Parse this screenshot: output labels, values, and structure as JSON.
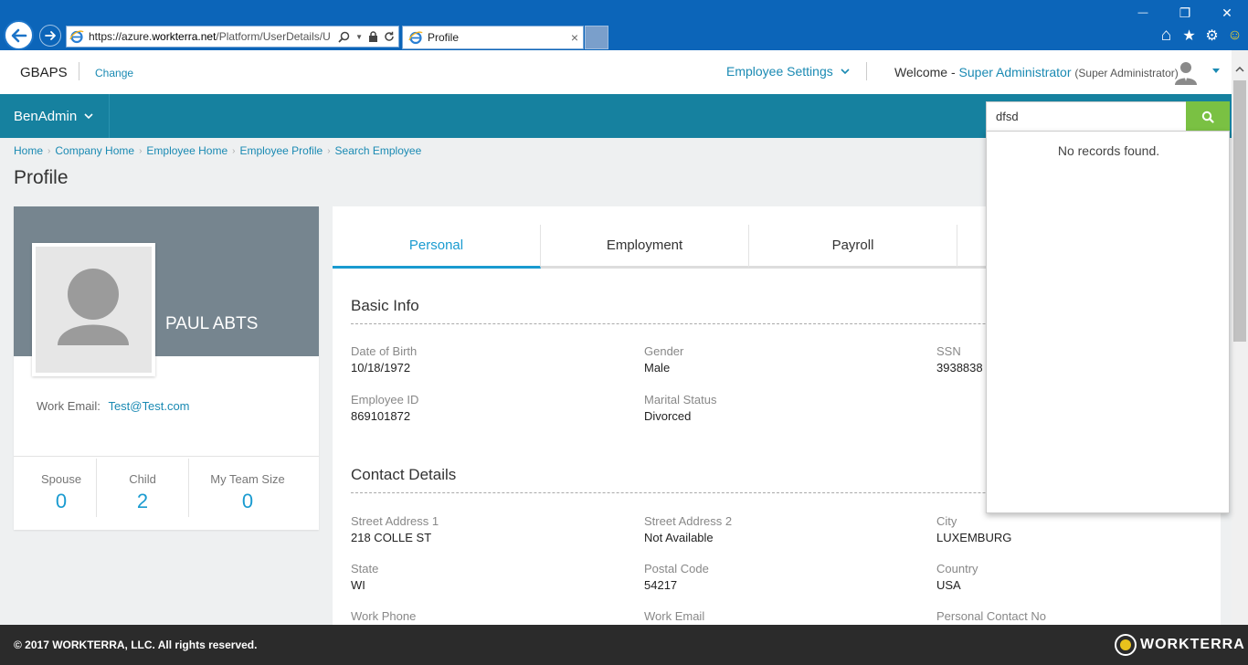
{
  "browser": {
    "url": "https://azure.workterra.net/Platform/UserDetails/U",
    "url_prefix": "https://azure.",
    "url_domain": "workterra.net",
    "url_path": "/Platform/UserDetails/U",
    "tab_title": "Profile",
    "tab_close": "×",
    "win_minimize": "—",
    "win_restore": "❐",
    "win_close": "✕",
    "tool_home": "⌂",
    "tool_favorites": "★",
    "tool_settings": "⚙",
    "tool_smiley": "☺"
  },
  "header": {
    "company": "GBAPS",
    "change_label": "Change",
    "employee_settings": "Employee Settings",
    "welcome_prefix": "Welcome -",
    "user_name": "Super Administrator",
    "user_role": "(Super Administrator)"
  },
  "nav": {
    "module": "BenAdmin",
    "search_value": "dfsd"
  },
  "breadcrumb": [
    "Home",
    "Company Home",
    "Employee Home",
    "Employee Profile",
    "Search Employee"
  ],
  "page_title": "Profile",
  "profile": {
    "name": "PAUL ABTS",
    "work_email_label": "Work Email:",
    "work_email": "Test@Test.com",
    "stats": [
      {
        "label": "Spouse",
        "value": "0"
      },
      {
        "label": "Child",
        "value": "2"
      },
      {
        "label": "My Team Size",
        "value": "0"
      }
    ]
  },
  "tabs": [
    "Personal",
    "Employment",
    "Payroll"
  ],
  "basic_info": {
    "title": "Basic Info",
    "fields": {
      "dob": {
        "label": "Date of Birth",
        "value": "10/18/1972"
      },
      "gender": {
        "label": "Gender",
        "value": "Male"
      },
      "ssn": {
        "label": "SSN",
        "value": "3938838"
      },
      "employee_id": {
        "label": "Employee ID",
        "value": "869101872"
      },
      "marital": {
        "label": "Marital Status",
        "value": "Divorced"
      }
    }
  },
  "contact_details": {
    "title": "Contact Details",
    "fields": {
      "street1": {
        "label": "Street Address 1",
        "value": "218 COLLE ST"
      },
      "street2": {
        "label": "Street Address 2",
        "value": "Not Available"
      },
      "city": {
        "label": "City",
        "value": "LUXEMBURG"
      },
      "state": {
        "label": "State",
        "value": "WI"
      },
      "postal": {
        "label": "Postal Code",
        "value": "54217"
      },
      "country": {
        "label": "Country",
        "value": "USA"
      },
      "work_phone": {
        "label": "Work Phone"
      },
      "work_email": {
        "label": "Work Email"
      },
      "personal_contact": {
        "label": "Personal Contact No"
      }
    }
  },
  "search_results": {
    "message": "No records found."
  },
  "footer": {
    "copyright": "© 2017 WORKTERRA, LLC. All rights reserved.",
    "logo_text": "WORKTERRA"
  },
  "colors": {
    "browser_blue": "#0c65b9",
    "nav_teal": "#16819f",
    "accent_blue": "#1a9bd0",
    "link_blue": "#1a8ab3",
    "search_green": "#7ac143",
    "banner_gray": "#76858f",
    "footer_dark": "#2b2b2b"
  }
}
